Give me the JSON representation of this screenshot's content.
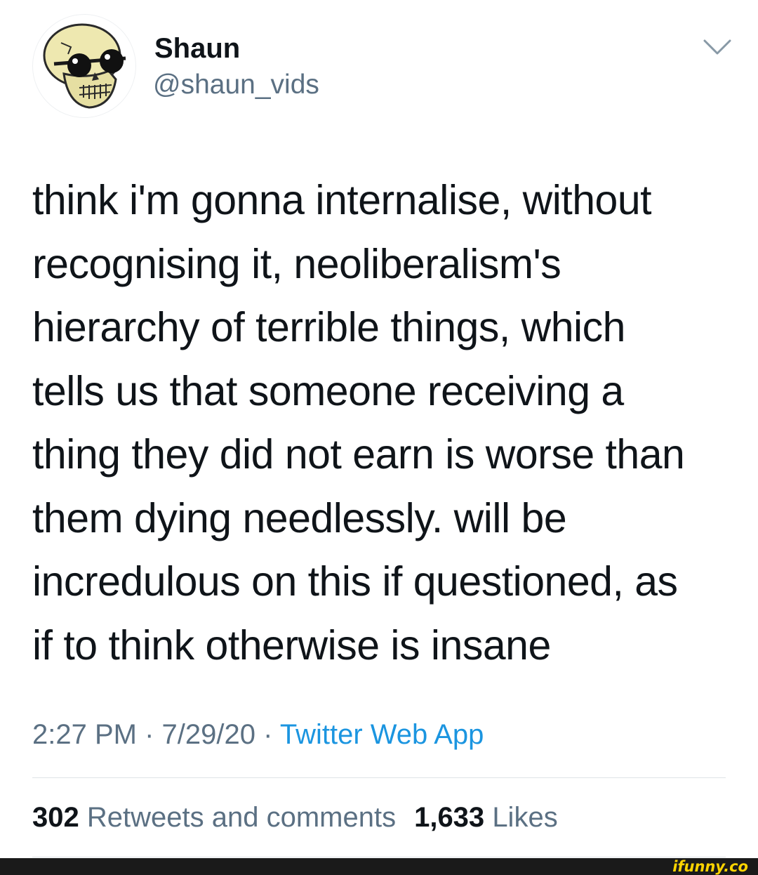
{
  "author": {
    "display_name": "Shaun",
    "handle": "@shaun_vids",
    "avatar_icon": "skull-with-sunglasses"
  },
  "menu_icon": "chevron-down-icon",
  "tweet": {
    "text": "think i'm gonna internalise, without\nrecognising it, neoliberalism's\nhierarchy of terrible things, which\ntells us that someone receiving a\nthing they did not earn is worse than\nthem dying needlessly. will be\nincredulous on this if questioned, as\nif to think otherwise is insane"
  },
  "meta": {
    "time": "2:27 PM",
    "separator": "·",
    "date": "7/29/20",
    "source": "Twitter Web App"
  },
  "stats": {
    "retweets_count": "302",
    "retweets_label": "Retweets and comments",
    "likes_count": "1,633",
    "likes_label": "Likes"
  },
  "watermark": {
    "text": "ifunny.co"
  },
  "colors": {
    "text_primary": "#0f1419",
    "text_secondary": "#5b7083",
    "link": "#1b95e0",
    "divider": "#dfe3e6",
    "watermark": "#ffd400"
  }
}
